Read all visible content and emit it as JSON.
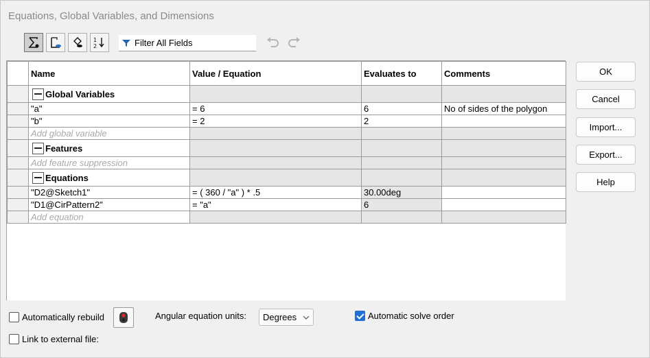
{
  "window": {
    "title": "Equations, Global Variables, and Dimensions"
  },
  "toolbar": {
    "buttons": [
      {
        "icon": "equation-view-icon",
        "active": true
      },
      {
        "icon": "sketch-equation-view-icon",
        "active": false
      },
      {
        "icon": "dimension-view-icon",
        "active": false
      },
      {
        "icon": "ordered-view-icon",
        "active": false
      }
    ],
    "filter_placeholder": "Filter All Fields"
  },
  "grid": {
    "columns": [
      "Name",
      "Value / Equation",
      "Evaluates to",
      "Comments"
    ],
    "sections": [
      {
        "label": "Global Variables",
        "rows": [
          {
            "name": "\"a\"",
            "value": "= 6",
            "evaluates": "6",
            "comment": "No of sides of the polygon"
          },
          {
            "name": "\"b\"",
            "value": "= 2",
            "evaluates": "2",
            "comment": ""
          }
        ],
        "add_label": "Add global variable"
      },
      {
        "label": "Features",
        "rows": [],
        "add_label": "Add feature suppression"
      },
      {
        "label": "Equations",
        "rows": [
          {
            "name": "\"D2@Sketch1\"",
            "value": "= ( 360 / \"a\" ) * .5",
            "evaluates": "30.00deg",
            "comment": ""
          },
          {
            "name": "\"D1@CirPattern2\"",
            "value": "= \"a\"",
            "evaluates": "6",
            "comment": ""
          }
        ],
        "add_label": "Add equation"
      }
    ]
  },
  "buttons": {
    "ok": "OK",
    "cancel": "Cancel",
    "import": "Import...",
    "export": "Export...",
    "help": "Help"
  },
  "bottom": {
    "auto_rebuild_label": "Automatically rebuild",
    "auto_rebuild_checked": false,
    "angular_units_label": "Angular equation units:",
    "angular_units_value": "Degrees",
    "auto_solve_label": "Automatic solve order",
    "auto_solve_checked": true,
    "link_external_label": "Link to external file:",
    "link_external_checked": false
  }
}
